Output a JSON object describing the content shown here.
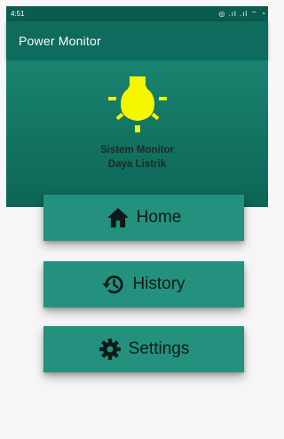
{
  "status_bar": {
    "time": "4:51",
    "icons_text": "◎ .ıl .ıl ⌔ ◔"
  },
  "app_bar": {
    "title": "Power Monitor"
  },
  "hero": {
    "icon": "lightbulb-icon",
    "bulb_color": "#f5f500",
    "line1": "Sistem Monitor",
    "line2": "Daya Listrik"
  },
  "menu": {
    "items": [
      {
        "label": "Home",
        "icon": "home-icon"
      },
      {
        "label": "History",
        "icon": "history-icon"
      },
      {
        "label": "Settings",
        "icon": "gear-icon"
      }
    ]
  },
  "colors": {
    "status_bar": "#0a5c4f",
    "app_bar": "#0e6b5d",
    "button": "#23917e",
    "background": "#f6f6f6"
  }
}
